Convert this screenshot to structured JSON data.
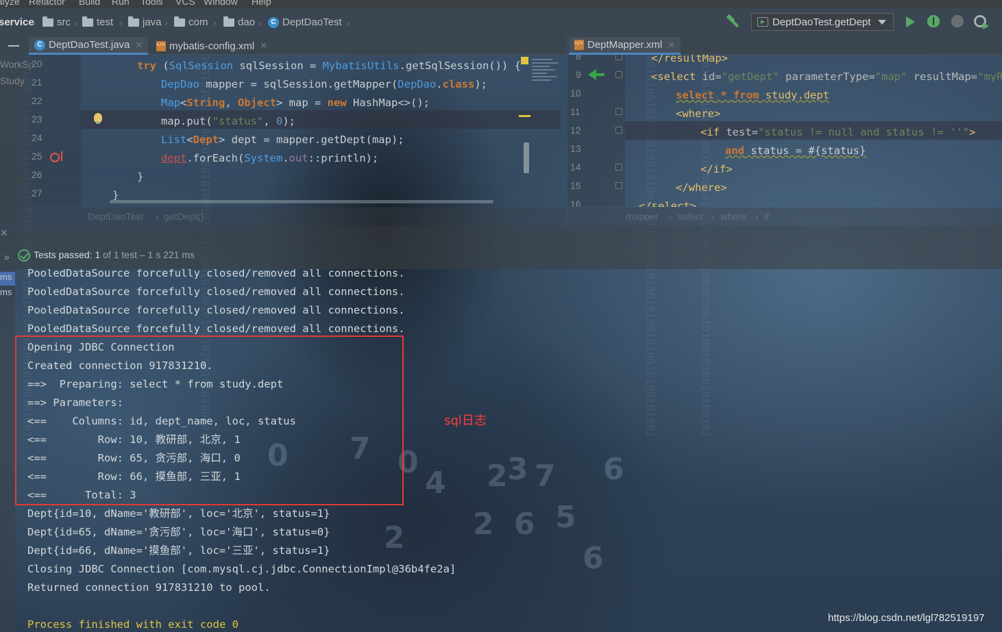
{
  "menu": {
    "items": [
      "alyze",
      "Refactor",
      "Build",
      "Run",
      "Tools",
      "VCS",
      "Window",
      "Help"
    ]
  },
  "navbar": {
    "crumbs": [
      "service",
      "src",
      "test",
      "java",
      "com",
      "dao",
      "DeptDaoTest"
    ],
    "run_config": "DeptDaoTest.getDept"
  },
  "left_strip": {
    "labels": [
      "WorkSp",
      "Study"
    ]
  },
  "left_editor": {
    "tabs": [
      {
        "label": "DeptDaoTest.java",
        "icon": "class-icon",
        "active": true
      },
      {
        "label": "mybatis-config.xml",
        "icon": "xml-icon",
        "active": false
      }
    ],
    "line_numbers": [
      "20",
      "21",
      "22",
      "23",
      "24",
      "25",
      "26",
      "27"
    ],
    "breadcrumb": [
      "DeptDaoTest",
      "getDept()"
    ]
  },
  "right_editor": {
    "tabs": [
      {
        "label": "DeptMapper.xml",
        "icon": "xml-icon",
        "active": true
      }
    ],
    "line_numbers": [
      "8",
      "9",
      "10",
      "11",
      "12",
      "13",
      "14",
      "15",
      "16"
    ],
    "breadcrumb": [
      "mapper",
      "select",
      "where",
      "if"
    ]
  },
  "run_panel": {
    "status_main": "Tests passed: 1",
    "status_sub": " of 1 test – 1 s 221 ms",
    "tree_items": [
      "ms",
      "ms"
    ]
  },
  "console": {
    "lines": [
      "PooledDataSource forcefully closed/removed all connections.",
      "PooledDataSource forcefully closed/removed all connections.",
      "PooledDataSource forcefully closed/removed all connections.",
      "PooledDataSource forcefully closed/removed all connections.",
      "Opening JDBC Connection",
      "Created connection 917831210.",
      "==>  Preparing: select * from study.dept",
      "==> Parameters: ",
      "<==    Columns: id, dept_name, loc, status",
      "<==        Row: 10, 教研部, 北京, 1",
      "<==        Row: 65, 贪污部, 海口, 0",
      "<==        Row: 66, 摸鱼部, 三亚, 1",
      "<==      Total: 3",
      "Dept{id=10, dName='教研部', loc='北京', status=1}",
      "Dept{id=65, dName='贪污部', loc='海口', status=0}",
      "Dept{id=66, dName='摸鱼部', loc='三亚', status=1}",
      "Closing JDBC Connection [com.mysql.cj.jdbc.ConnectionImpl@36b4fe2a]",
      "Returned connection 917831210 to pool.",
      "",
      "Process finished with exit code 0"
    ]
  },
  "annotation": {
    "sql_log_label": "sql日志"
  },
  "watermark": "https://blog.csdn.net/lgl782519197",
  "colors": {
    "accent_tab": "#4a88c7",
    "keyword": "#cc7832",
    "string": "#6a8759",
    "class": "#4e9de0",
    "xml_tag": "#e8bf6a",
    "annotation_red": "#e53935",
    "exit_yellow": "#e0c440",
    "pass_green": "#59a869"
  }
}
